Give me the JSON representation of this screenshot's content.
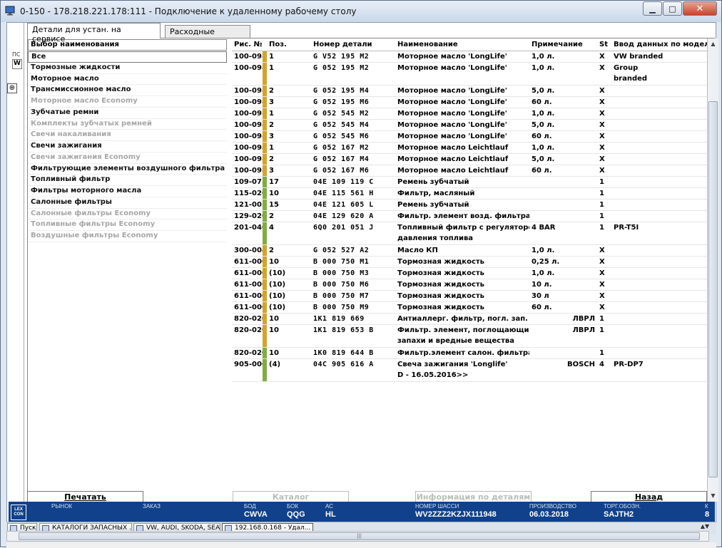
{
  "window": {
    "title": "0-150 - 178.218.221.178:111 - Подключение к удаленному рабочему столу",
    "min_glyph": "▁",
    "max_glyph": "□",
    "close_glyph": "✕"
  },
  "left_strip": {
    "label": "ПС",
    "value": "W",
    "expand_glyph": "⊕"
  },
  "tabs": [
    {
      "label": "Детали для устан. на сервисе",
      "active": true
    },
    {
      "label": "Расходные детали",
      "active": false
    }
  ],
  "categories": {
    "header": "Выбор наименования",
    "items": [
      {
        "label": "Все",
        "enabled": true,
        "selected": true
      },
      {
        "label": "Тормозные жидкости",
        "enabled": true
      },
      {
        "label": "Моторное масло",
        "enabled": true
      },
      {
        "label": "Трансмиссионное масло",
        "enabled": true
      },
      {
        "label": "Моторное масло Economy",
        "enabled": false
      },
      {
        "label": "Зубчатые ремни",
        "enabled": true
      },
      {
        "label": "Комплекты зубчатых ремней",
        "enabled": false
      },
      {
        "label": "Свечи накаливания",
        "enabled": false
      },
      {
        "label": "Свечи зажигания",
        "enabled": true
      },
      {
        "label": "Свечи зажигания Economy",
        "enabled": false
      },
      {
        "label": "Фильтрующие элементы воздушного фильтра",
        "enabled": true
      },
      {
        "label": "Топливный фильтр",
        "enabled": true
      },
      {
        "label": "Фильтры моторного масла",
        "enabled": true
      },
      {
        "label": "Салонные фильтры",
        "enabled": true
      },
      {
        "label": "Салонные фильтры Economy",
        "enabled": false
      },
      {
        "label": "Топливные фильтры Economy",
        "enabled": false
      },
      {
        "label": "Воздушные фильтры Economy",
        "enabled": false
      }
    ]
  },
  "parts_table": {
    "columns": [
      "Рис. №",
      "Поз.",
      "Номер детали",
      "Наименование",
      "Примечание",
      "St",
      "Ввод данных по модели"
    ],
    "rows": [
      {
        "fig": "100-098",
        "mark": "#d4a429",
        "pos": "1",
        "pn": "G   V52 195 M2",
        "name": "Моторное масло 'LongLife'",
        "note": "1,0 л.",
        "st": "X",
        "model": "VW branded"
      },
      {
        "fig": "100-098",
        "mark": "#d4a429",
        "pos": "1",
        "pn": "G   052 195 M2",
        "name": "Моторное масло 'LongLife'",
        "note": "1,0 л.",
        "st": "X",
        "model": "Group",
        "model2": "branded"
      },
      {
        "fig": "100-098",
        "mark": "#d4a429",
        "pos": "2",
        "pn": "G   052 195 M4",
        "name": "Моторное масло 'LongLife'",
        "note": "5,0 л.",
        "st": "X",
        "model": ""
      },
      {
        "fig": "100-098",
        "mark": "#d4a429",
        "pos": "3",
        "pn": "G   052 195 M6",
        "name": "Моторное масло 'LongLife'",
        "note": "60 л.",
        "st": "X",
        "model": ""
      },
      {
        "fig": "100-098",
        "mark": "#d4a429",
        "pos": "1",
        "pn": "G   052 545 M2",
        "name": "Моторное масло 'LongLife'",
        "note": "1,0 л.",
        "st": "X",
        "model": ""
      },
      {
        "fig": "100-098",
        "mark": "#d4a429",
        "pos": "2",
        "pn": "G   052 545 M4",
        "name": "Моторное масло 'LongLife'",
        "note": "5,0 л.",
        "st": "X",
        "model": ""
      },
      {
        "fig": "100-098",
        "mark": "#d4a429",
        "pos": "3",
        "pn": "G   052 545 M6",
        "name": "Моторное масло 'LongLife'",
        "note": "60 л.",
        "st": "X",
        "model": ""
      },
      {
        "fig": "100-098",
        "mark": "#d4a429",
        "pos": "1",
        "pn": "G   052 167 M2",
        "name": "Моторное масло Leichtlauf",
        "note": "1,0 л.",
        "st": "X",
        "model": ""
      },
      {
        "fig": "100-098",
        "mark": "#d4a429",
        "pos": "2",
        "pn": "G   052 167 M4",
        "name": "Моторное масло Leichtlauf",
        "note": "5,0 л.",
        "st": "X",
        "model": ""
      },
      {
        "fig": "100-098",
        "mark": "#d4a429",
        "pos": "3",
        "pn": "G   052 167 M6",
        "name": "Моторное масло Leichtlauf",
        "note": "60 л.",
        "st": "X",
        "model": ""
      },
      {
        "fig": "109-075",
        "mark": "#7fae3e",
        "pos": "17",
        "pn": "04E 109 119 C",
        "name": "Ремень зубчатый",
        "note": "",
        "st": "1",
        "model": ""
      },
      {
        "fig": "115-020",
        "mark": "#7fae3e",
        "pos": "10",
        "pn": "04E 115 561 H",
        "name": "Фильтр, масляный",
        "note": "",
        "st": "1",
        "model": ""
      },
      {
        "fig": "121-005",
        "mark": "#7fae3e",
        "pos": "15",
        "pn": "04E 121 605 L",
        "name": "Ремень зубчатый",
        "note": "",
        "st": "1",
        "model": ""
      },
      {
        "fig": "129-020",
        "mark": "#7fae3e",
        "pos": "2",
        "pn": "04E 129 620 A",
        "name": "Фильтр. элемент возд. фильтра",
        "note": "",
        "st": "1",
        "model": ""
      },
      {
        "fig": "201-040",
        "mark": "#7fae3e",
        "pos": "4",
        "pn": "6Q0 201 051 J",
        "name": "Топливный фильтр с регулятором",
        "name2": "давления топлива",
        "note": "4 BAR",
        "st": "1",
        "model": "PR-T5I"
      },
      {
        "fig": "300-004",
        "mark": "#d4a429",
        "pos": "2",
        "pn": "G   052 527 A2",
        "name": "Масло КП",
        "note": "1,0 л.",
        "st": "X",
        "model": ""
      },
      {
        "fig": "611-000",
        "mark": "#d4a429",
        "pos": "10",
        "pn": "B   000 750 M1",
        "name": "Тормозная жидкость",
        "note": "0,25 л.",
        "st": "X",
        "model": ""
      },
      {
        "fig": "611-000",
        "mark": "#d4a429",
        "pos": "(10)",
        "pn": "B   000 750 M3",
        "name": "Тормозная жидкость",
        "note": "1,0 л.",
        "st": "X",
        "model": ""
      },
      {
        "fig": "611-000",
        "mark": "#d4a429",
        "pos": "(10)",
        "pn": "B   000 750 M6",
        "name": "Тормозная жидкость",
        "note": "10 л.",
        "st": "X",
        "model": ""
      },
      {
        "fig": "611-000",
        "mark": "#d4a429",
        "pos": "(10)",
        "pn": "B   000 750 M7",
        "name": "Тормозная жидкость",
        "note": "30 л",
        "st": "X",
        "model": ""
      },
      {
        "fig": "611-000",
        "mark": "#d4a429",
        "pos": "(10)",
        "pn": "B   000 750 M9",
        "name": "Тормозная жидкость",
        "note": "60 л.",
        "st": "X",
        "model": ""
      },
      {
        "fig": "820-020",
        "mark": "#d4a429",
        "pos": "10",
        "pn": "1K1 819 669",
        "name": "Антиаллерг. фильтр, погл. зап.",
        "note": "ЛВРЛ",
        "st": "1",
        "model": ""
      },
      {
        "fig": "820-020",
        "mark": "#d4a429",
        "pos": "10",
        "pn": "1K1 819 653 B",
        "name": "Фильтр. элемент, поглощающий",
        "name2": "запахи и вредные вещества",
        "note": "ЛВРЛ",
        "st": "1",
        "model": ""
      },
      {
        "fig": "820-020",
        "mark": "#7fae3e",
        "pos": "10",
        "pn": "1K0 819 644 B",
        "name": "Фильтр.элемент салон. фильтра",
        "note": "",
        "st": "1",
        "model": ""
      },
      {
        "fig": "905-000",
        "mark": "#7fae3e",
        "pos": "(4)",
        "pn": "04C 905 616 A",
        "name": "Свеча зажигания 'Longlife'",
        "name2": "D - 16.05.2016>>",
        "note": "BOSCH",
        "st": "4",
        "model": "PR-DP7"
      }
    ]
  },
  "actions": {
    "print": "Печатать",
    "catalog": "Каталог",
    "info": "Информация по деталям",
    "back": "Назад"
  },
  "info_bar": {
    "logo": "LEX CON",
    "market_label": "РЫНОК",
    "order_label": "ЗАКАЗ",
    "bod_label": "БОД",
    "bod_value": "CWVA",
    "bok_label": "БОК",
    "bok_value": "QQG",
    "ac_label": "АС",
    "ac_value": "HL",
    "chassis_label": "НОМЕР ШАССИ",
    "chassis_value": "WV2ZZZ2KZJX111948",
    "production_label": "ПРОИЗВОДСТВО",
    "production_value": "06.03.2018",
    "trade_label": "ТОРГ.ОБОЗН.",
    "trade_value": "SAJTH2",
    "extra_label": "К",
    "extra_value": "8"
  },
  "taskbar": {
    "start": "Пуск",
    "items": [
      "КАТАЛОГИ ЗАПАСНЫХ ...",
      "VW, AUDI, SKODA, SEAT",
      "192.168.0.168 - Удал..."
    ]
  }
}
